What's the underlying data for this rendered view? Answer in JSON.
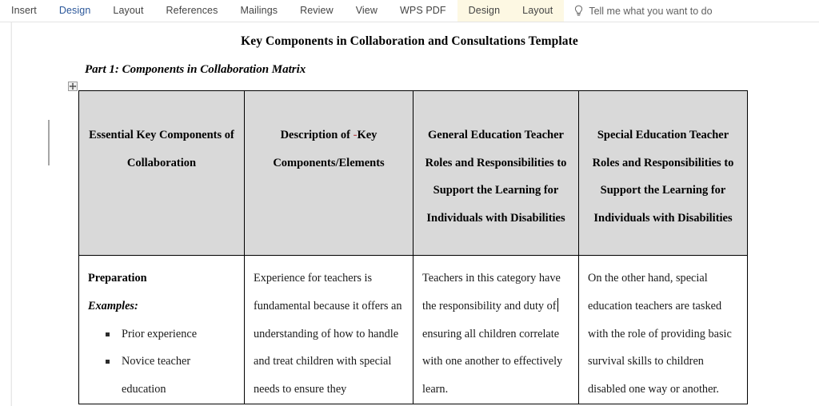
{
  "ribbon": {
    "tabs": [
      {
        "label": "Insert",
        "state": "normal"
      },
      {
        "label": "Design",
        "state": "active"
      },
      {
        "label": "Layout",
        "state": "normal"
      },
      {
        "label": "References",
        "state": "normal"
      },
      {
        "label": "Mailings",
        "state": "normal"
      },
      {
        "label": "Review",
        "state": "normal"
      },
      {
        "label": "View",
        "state": "normal"
      },
      {
        "label": "WPS PDF",
        "state": "normal"
      },
      {
        "label": "Design",
        "state": "contextual"
      },
      {
        "label": "Layout",
        "state": "contextual"
      }
    ],
    "tell_me": {
      "label": "Tell me what you want to do",
      "icon": "lightbulb-icon"
    },
    "colors": {
      "active_tab": "#2b579a",
      "contextual_tab_bg": "#fdf8e3",
      "tab_text": "#444444",
      "tell_me_text": "#616161"
    }
  },
  "document": {
    "title": "Key Components in Collaboration and Consultations Template",
    "part_heading": "Part 1: Components in Collaboration Matrix",
    "table_move_handle_icon": "move-cross-icon",
    "change_bar_present": true
  },
  "table": {
    "header_bg": "#d9d9d9",
    "border_color": "#000000",
    "headers": [
      {
        "lines": [
          "Essential Key Components of",
          "Collaboration"
        ]
      },
      {
        "pre": "Description of ",
        "hyphen": "-",
        "post": "Key",
        "lines": [
          "Description of -Key",
          "Components/Elements"
        ]
      },
      {
        "lines": [
          "General Education Teacher",
          "Roles and Responsibilities to",
          "Support the Learning for",
          "Individuals with Disabilities"
        ]
      },
      {
        "lines": [
          "Special Education Teacher",
          "Roles and Responsibilities to",
          "Support the Learning for",
          "Individuals with Disabilities"
        ]
      }
    ],
    "row1": {
      "col1": {
        "heading": "Preparation",
        "examples_label": "Examples:",
        "bullets": [
          "Prior experience",
          "Novice teacher education"
        ]
      },
      "col2": {
        "text": "Experience for teachers is fundamental because it offers an understanding of how to handle and treat children with special needs to ensure they"
      },
      "col3": {
        "text_before_caret": "Teachers in this category have the responsibility and duty of",
        "text_after_caret": " ensuring all children correlate with one another to effectively learn.",
        "caret_visible": true
      },
      "col4": {
        "text": "On the other hand, special education teachers are tasked with the role of providing basic survival skills to children disabled one way or another."
      }
    }
  }
}
